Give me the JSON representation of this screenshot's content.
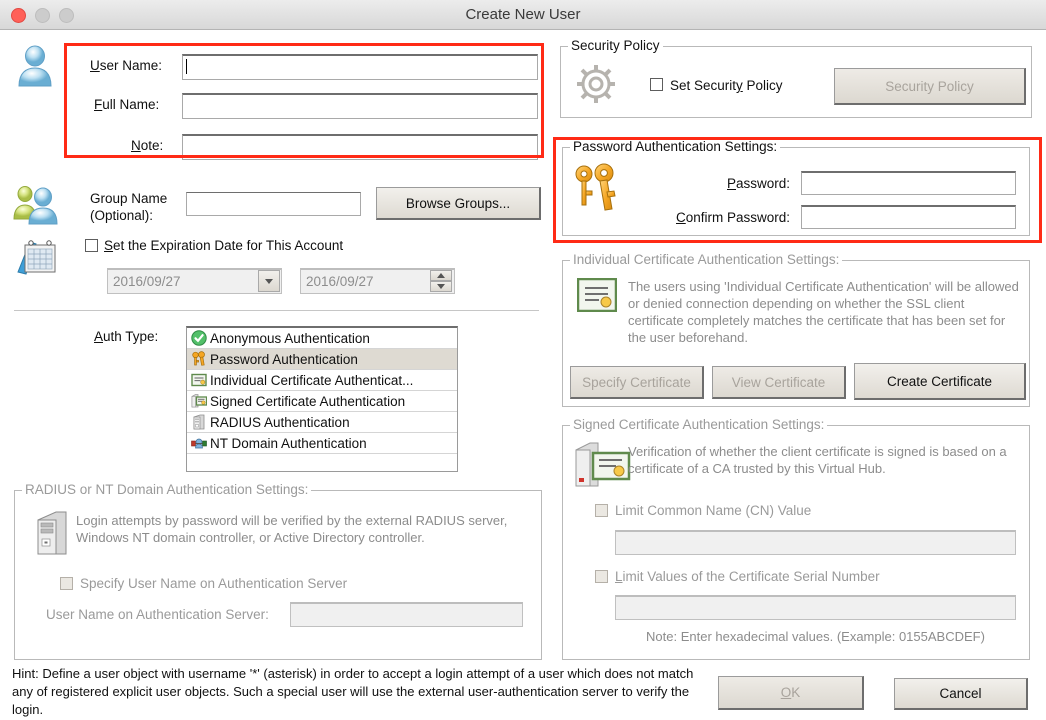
{
  "window": {
    "title": "Create New User",
    "traffic_lights": [
      "close-button",
      "minimize-button",
      "maximize-button"
    ]
  },
  "user_fields": {
    "user_name_label": "User Name:",
    "user_name_value": "",
    "full_name_label": "Full Name:",
    "full_name_value": "",
    "note_label": "Note:",
    "note_value": ""
  },
  "group": {
    "label_line1": "Group Name",
    "label_line2": "(Optional):",
    "value": "",
    "browse_button": "Browse Groups..."
  },
  "expiration": {
    "checkbox_label": "Set the Expiration Date for This Account",
    "checked": false,
    "date_value": "2016/09/27",
    "time_value": "2016/09/27"
  },
  "auth_type": {
    "label": "Auth Type:",
    "items": [
      {
        "label": "Anonymous Authentication",
        "icon": "green-check-icon",
        "selected": false
      },
      {
        "label": "Password Authentication",
        "icon": "keys-icon",
        "selected": true
      },
      {
        "label": "Individual Certificate Authenticat...",
        "icon": "certificate-icon",
        "selected": false
      },
      {
        "label": "Signed Certificate Authentication",
        "icon": "signed-certificate-icon",
        "selected": false
      },
      {
        "label": "RADIUS Authentication",
        "icon": "server-icon",
        "selected": false
      },
      {
        "label": "NT Domain Authentication",
        "icon": "nt-domain-icon",
        "selected": false
      }
    ]
  },
  "radius_group": {
    "caption": "RADIUS or NT Domain Authentication Settings:",
    "description": "Login attempts by password will be verified by the external RADIUS server, Windows NT domain controller, or Active Directory controller.",
    "specify_checkbox_label": "Specify User Name on Authentication Server",
    "specify_checked": false,
    "username_label": "User Name on Authentication Server:",
    "username_value": ""
  },
  "security_policy": {
    "caption": "Security Policy",
    "checkbox_label": "Set Security Policy",
    "checked": false,
    "button_label": "Security Policy",
    "button_disabled": true
  },
  "password_group": {
    "caption": "Password Authentication Settings:",
    "password_label": "Password:",
    "password_value": "",
    "confirm_label": "Confirm Password:",
    "confirm_value": ""
  },
  "individual_cert": {
    "caption": "Individual Certificate Authentication Settings:",
    "description": "The users using 'Individual Certificate Authentication' will be allowed or denied connection depending on whether the SSL client certificate completely matches the certificate that has been set for the user beforehand.",
    "buttons": [
      {
        "label": "Specify Certificate",
        "disabled": true
      },
      {
        "label": "View Certificate",
        "disabled": true
      },
      {
        "label": "Create Certificate",
        "disabled": false
      }
    ]
  },
  "signed_cert": {
    "caption": "Signed Certificate Authentication Settings:",
    "description": "Verification of whether the client certificate is signed is based on a certificate of a CA trusted by this Virtual Hub.",
    "cn_checkbox_label": "Limit Common Name (CN) Value",
    "cn_checked": false,
    "cn_value": "",
    "serial_checkbox_label": "Limit Values of the Certificate Serial Number",
    "serial_checked": false,
    "serial_value": "",
    "note": "Note: Enter hexadecimal values. (Example: 0155ABCDEF)"
  },
  "hint": "Hint: Define a user object with username '*' (asterisk) in order to accept a login attempt of a user which does not match any of registered explicit user objects. Such a special user will use the external user-authentication server to verify the login.",
  "footer": {
    "ok_label": "OK",
    "ok_disabled": true,
    "cancel_label": "Cancel"
  },
  "highlight_color": "#ff2a16"
}
